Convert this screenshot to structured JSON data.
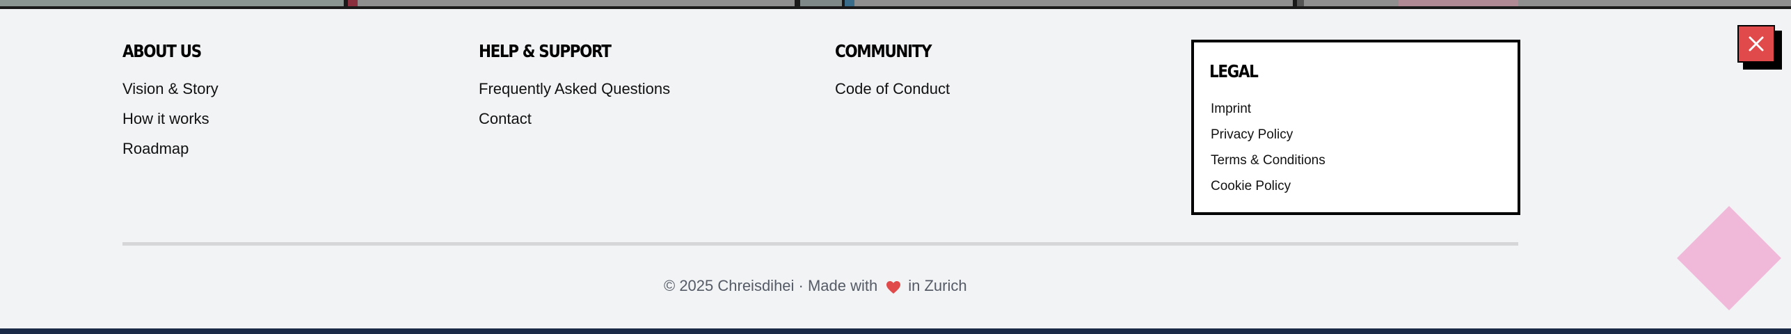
{
  "columns": {
    "about": {
      "heading": "About Us",
      "links": [
        "Vision & Story",
        "How it works",
        "Roadmap"
      ]
    },
    "help": {
      "heading": "Help & Support",
      "links": [
        "Frequently Asked Questions",
        "Contact"
      ]
    },
    "community": {
      "heading": "Community",
      "links": [
        "Code of Conduct"
      ]
    },
    "legal": {
      "heading": "Legal",
      "links": [
        "Imprint",
        "Privacy Policy",
        "Terms & Conditions",
        "Cookie Policy"
      ]
    }
  },
  "copyright": {
    "prefix": "© 2025 Chreisdihei · Made with",
    "suffix": "in Zurich",
    "heart_icon": "heart-icon"
  },
  "close_button": {
    "icon": "close-icon"
  },
  "colors": {
    "background": "#f2f3f5",
    "accent_red": "#e04a4a",
    "decor_pink": "#f1b9d9",
    "bottom_bar": "#1b2a47",
    "divider": "#d6d6d8"
  }
}
